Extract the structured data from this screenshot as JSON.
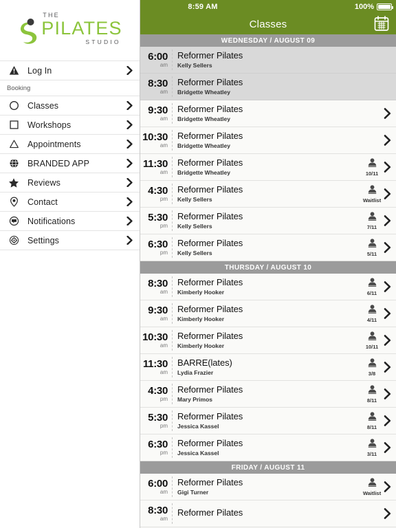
{
  "brand": {
    "logo_the": "THE",
    "logo_main": "PILATES",
    "logo_studio": "STUDIO",
    "green": "#6b8c23",
    "logo_green": "#8cc43c"
  },
  "sidebar": {
    "items": [
      {
        "label": "Log In",
        "icon": "warning-triangle-icon",
        "name": "login"
      },
      {
        "label": "Classes",
        "icon": "circle-icon",
        "name": "classes"
      },
      {
        "label": "Workshops",
        "icon": "square-icon",
        "name": "workshops"
      },
      {
        "label": "Appointments",
        "icon": "triangle-icon",
        "name": "appointments"
      },
      {
        "label": "BRANDED APP",
        "icon": "globe-icon",
        "name": "branded-app"
      },
      {
        "label": "Reviews",
        "icon": "star-icon",
        "name": "reviews"
      },
      {
        "label": "Contact",
        "icon": "map-pin-icon",
        "name": "contact"
      },
      {
        "label": "Notifications",
        "icon": "chat-bubble-icon",
        "name": "notifications"
      },
      {
        "label": "Settings",
        "icon": "gear-icon",
        "name": "settings"
      }
    ],
    "section_booking": "Booking"
  },
  "statusbar": {
    "time": "8:59 AM",
    "battery_pct": "100%"
  },
  "navbar": {
    "title": "Classes",
    "calendar_icon": "calendar-icon"
  },
  "schedule": [
    {
      "day_label": "WEDNESDAY / AUGUST 09",
      "classes": [
        {
          "time": "6:00",
          "ampm": "am",
          "name": "Reformer Pilates",
          "instructor": "Kelly Sellers",
          "capacity": "",
          "dim": true,
          "chevron": false
        },
        {
          "time": "8:30",
          "ampm": "am",
          "name": "Reformer Pilates",
          "instructor": "Bridgette Wheatley",
          "capacity": "",
          "dim": true,
          "chevron": false
        },
        {
          "time": "9:30",
          "ampm": "am",
          "name": "Reformer Pilates",
          "instructor": "Bridgette Wheatley",
          "capacity": "",
          "dim": false,
          "chevron": true
        },
        {
          "time": "10:30",
          "ampm": "am",
          "name": "Reformer Pilates",
          "instructor": "Bridgette Wheatley",
          "capacity": "",
          "dim": false,
          "chevron": true
        },
        {
          "time": "11:30",
          "ampm": "am",
          "name": "Reformer Pilates",
          "instructor": "Bridgette Wheatley",
          "capacity": "10/11",
          "dim": false,
          "chevron": true
        },
        {
          "time": "4:30",
          "ampm": "pm",
          "name": "Reformer Pilates",
          "instructor": "Kelly Sellers",
          "capacity": "Waitlist",
          "dim": false,
          "chevron": true
        },
        {
          "time": "5:30",
          "ampm": "pm",
          "name": "Reformer Pilates",
          "instructor": "Kelly Sellers",
          "capacity": "7/11",
          "dim": false,
          "chevron": true
        },
        {
          "time": "6:30",
          "ampm": "pm",
          "name": "Reformer Pilates",
          "instructor": "Kelly Sellers",
          "capacity": "5/11",
          "dim": false,
          "chevron": true
        }
      ]
    },
    {
      "day_label": "THURSDAY / AUGUST 10",
      "classes": [
        {
          "time": "8:30",
          "ampm": "am",
          "name": "Reformer Pilates",
          "instructor": "Kimberly Hooker",
          "capacity": "6/11",
          "dim": false,
          "chevron": true
        },
        {
          "time": "9:30",
          "ampm": "am",
          "name": "Reformer Pilates",
          "instructor": "Kimberly Hooker",
          "capacity": "4/11",
          "dim": false,
          "chevron": true
        },
        {
          "time": "10:30",
          "ampm": "am",
          "name": "Reformer Pilates",
          "instructor": "Kimberly Hooker",
          "capacity": "10/11",
          "dim": false,
          "chevron": true
        },
        {
          "time": "11:30",
          "ampm": "am",
          "name": "BARRE(lates)",
          "instructor": "Lydia Frazier",
          "capacity": "3/8",
          "dim": false,
          "chevron": true
        },
        {
          "time": "4:30",
          "ampm": "pm",
          "name": "Reformer Pilates",
          "instructor": "Mary Primos",
          "capacity": "8/11",
          "dim": false,
          "chevron": true
        },
        {
          "time": "5:30",
          "ampm": "pm",
          "name": "Reformer Pilates",
          "instructor": "Jessica Kassel",
          "capacity": "8/11",
          "dim": false,
          "chevron": true
        },
        {
          "time": "6:30",
          "ampm": "pm",
          "name": "Reformer Pilates",
          "instructor": "Jessica Kassel",
          "capacity": "3/11",
          "dim": false,
          "chevron": true
        }
      ]
    },
    {
      "day_label": "FRIDAY / AUGUST 11",
      "classes": [
        {
          "time": "6:00",
          "ampm": "am",
          "name": "Reformer Pilates",
          "instructor": "Gigi Turner",
          "capacity": "Waitlist",
          "dim": false,
          "chevron": true
        },
        {
          "time": "8:30",
          "ampm": "am",
          "name": "Reformer Pilates",
          "instructor": "",
          "capacity": "",
          "dim": false,
          "chevron": true
        }
      ]
    }
  ]
}
